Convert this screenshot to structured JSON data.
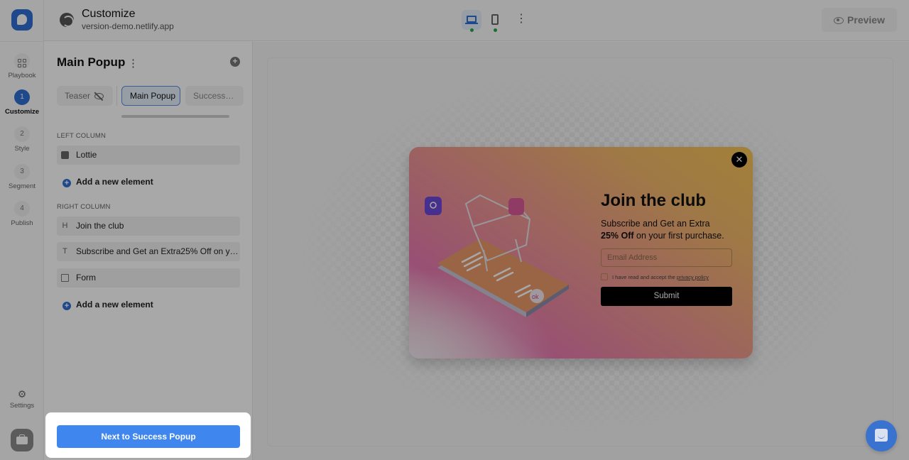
{
  "rail": {
    "items": [
      {
        "label": "Playbook",
        "badge": ""
      },
      {
        "label": "Customize",
        "badge": "1"
      },
      {
        "label": "Style",
        "badge": "2"
      },
      {
        "label": "Segment",
        "badge": "3"
      },
      {
        "label": "Publish",
        "badge": "4"
      }
    ],
    "settings_label": "Settings",
    "settings_icon": "⚙"
  },
  "header": {
    "title": "Customize",
    "subtitle": "version-demo.netlify.app",
    "preview_label": "Preview",
    "kebab": "⋮"
  },
  "panel": {
    "title": "Main Popup",
    "kebab": "⋮",
    "add": "+",
    "tabs": [
      {
        "label": "Teaser"
      },
      {
        "label": "Main Popup"
      },
      {
        "label": "Success Po..."
      }
    ],
    "left_column_label": "LEFT COLUMN",
    "right_column_label": "RIGHT COLUMN",
    "left_elements": [
      {
        "label": "Lottie",
        "icon": ""
      }
    ],
    "right_elements": [
      {
        "label": "Join the club",
        "icon": "H"
      },
      {
        "label": "Subscribe and Get an Extra25% Off on your first purchase.",
        "icon": "T"
      },
      {
        "label": "Form",
        "icon": ""
      }
    ],
    "add_element_label": "Add a new element",
    "add_icon": "+"
  },
  "popup": {
    "close": "✕",
    "title": "Join the club",
    "subtitle_line1": "Subscribe and Get an Extra",
    "subtitle_bold": "25% Off",
    "subtitle_line2": " on your first purchase.",
    "email_placeholder": "Email Address",
    "consent_text": "I have read and accept the ",
    "consent_link": "privacy policy",
    "submit_label": "Submit"
  },
  "footer": {
    "next_label": "Next to Success Popup"
  },
  "colors": {
    "brand": "#2f6fd4",
    "next_button": "#3f87ee",
    "status_dot": "#27a844"
  }
}
